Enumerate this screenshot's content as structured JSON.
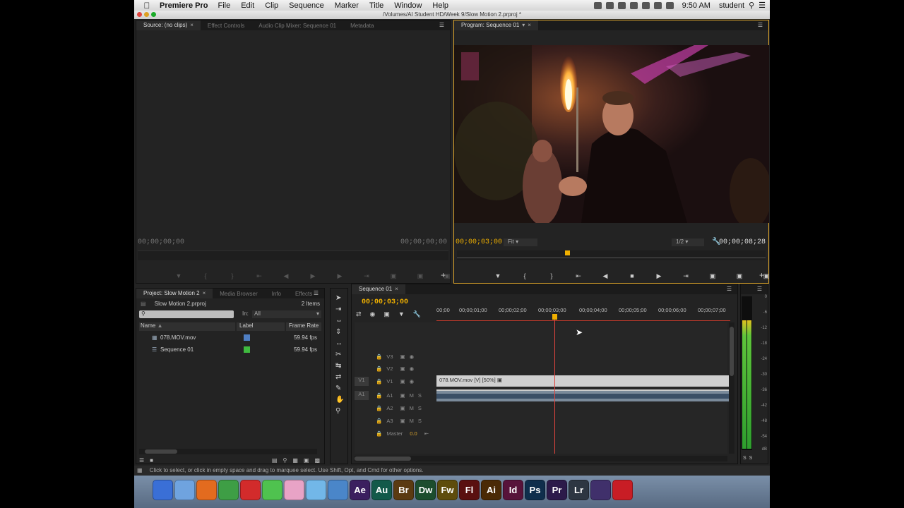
{
  "menubar": {
    "app_name": "Premiere Pro",
    "items": [
      "File",
      "Edit",
      "Clip",
      "Sequence",
      "Marker",
      "Title",
      "Window",
      "Help"
    ],
    "time": "9:50 AM",
    "user": "student"
  },
  "window_title": "/Volumes/AI Student HD/Week 9/Slow Motion 2.prproj *",
  "source_panel": {
    "tabs": [
      "Source: (no clips)",
      "Effect Controls",
      "Audio Clip Mixer: Sequence 01",
      "Metadata"
    ],
    "timecode_left": "00;00;00;00",
    "timecode_right": "00;00;00;00"
  },
  "program_panel": {
    "tab": "Program: Sequence 01",
    "timecode_current": "00;00;03;00",
    "fit": "Fit",
    "resolution": "1/2",
    "timecode_duration": "00;00;08;28"
  },
  "project_panel": {
    "tabs": [
      "Project: Slow Motion 2",
      "Media Browser",
      "Info",
      "Effects"
    ],
    "project_file": "Slow Motion 2.prproj",
    "item_count": "2 Items",
    "search_in_label": "In:",
    "search_in_value": "All",
    "columns": [
      "Name",
      "Label",
      "Frame Rate"
    ],
    "rows": [
      {
        "name": "078.MOV.mov",
        "label_color": "#4f7fc4",
        "frame_rate": "59.94 fps"
      },
      {
        "name": "Sequence 01",
        "label_color": "#3fba3f",
        "frame_rate": "59.94 fps"
      }
    ]
  },
  "timeline": {
    "tab": "Sequence 01",
    "timecode": "00;00;03;00",
    "ruler": [
      "00;00",
      "00;00;01;00",
      "00;00;02;00",
      "00;00;03;00",
      "00;00;04;00",
      "00;00;05;00",
      "00;00;06;00",
      "00;00;07;00"
    ],
    "video_tracks": [
      "V3",
      "V2",
      "V1"
    ],
    "audio_tracks": [
      "A1",
      "A2",
      "A3"
    ],
    "source_v": "V1",
    "source_a": "A1",
    "master_label": "Master",
    "master_value": "0.0",
    "clip_label": "078.MOV.mov [V] [50%]",
    "mute_letter": "M",
    "solo_letter": "S"
  },
  "audio_meter": {
    "scale": [
      "0",
      "-6",
      "-12",
      "-18",
      "-24",
      "-30",
      "-36",
      "-42",
      "-48",
      "-54",
      "dB"
    ],
    "buttons": [
      "S",
      "S"
    ]
  },
  "status": "Click to select, or click in empty space and drag to marquee select. Use Shift, Opt, and Cmd for other options.",
  "dock": {
    "apps": [
      {
        "label": "",
        "color": "#3a6fd6"
      },
      {
        "label": "",
        "color": "#6fa3df"
      },
      {
        "label": "",
        "color": "#e36b1f"
      },
      {
        "label": "",
        "color": "#3e9e45"
      },
      {
        "label": "",
        "color": "#d22b2b"
      },
      {
        "label": "",
        "color": "#4fc24f"
      },
      {
        "label": "",
        "color": "#e8a3c6"
      },
      {
        "label": "",
        "color": "#72b7e8"
      },
      {
        "label": "",
        "color": "#4a86c9"
      },
      {
        "label": "Ae",
        "color": "#3b1f5f"
      },
      {
        "label": "Au",
        "color": "#135a4a"
      },
      {
        "label": "Br",
        "color": "#5b3a12"
      },
      {
        "label": "Dw",
        "color": "#1c4d2e"
      },
      {
        "label": "Fw",
        "color": "#5e4c0c"
      },
      {
        "label": "Fl",
        "color": "#5a1010"
      },
      {
        "label": "Ai",
        "color": "#4a2a06"
      },
      {
        "label": "Id",
        "color": "#57133a"
      },
      {
        "label": "Ps",
        "color": "#0f2e4c"
      },
      {
        "label": "Pr",
        "color": "#2c1a4a"
      },
      {
        "label": "Lr",
        "color": "#2d3642"
      },
      {
        "label": "",
        "color": "#40306b"
      },
      {
        "label": "",
        "color": "#c81d25"
      }
    ]
  }
}
